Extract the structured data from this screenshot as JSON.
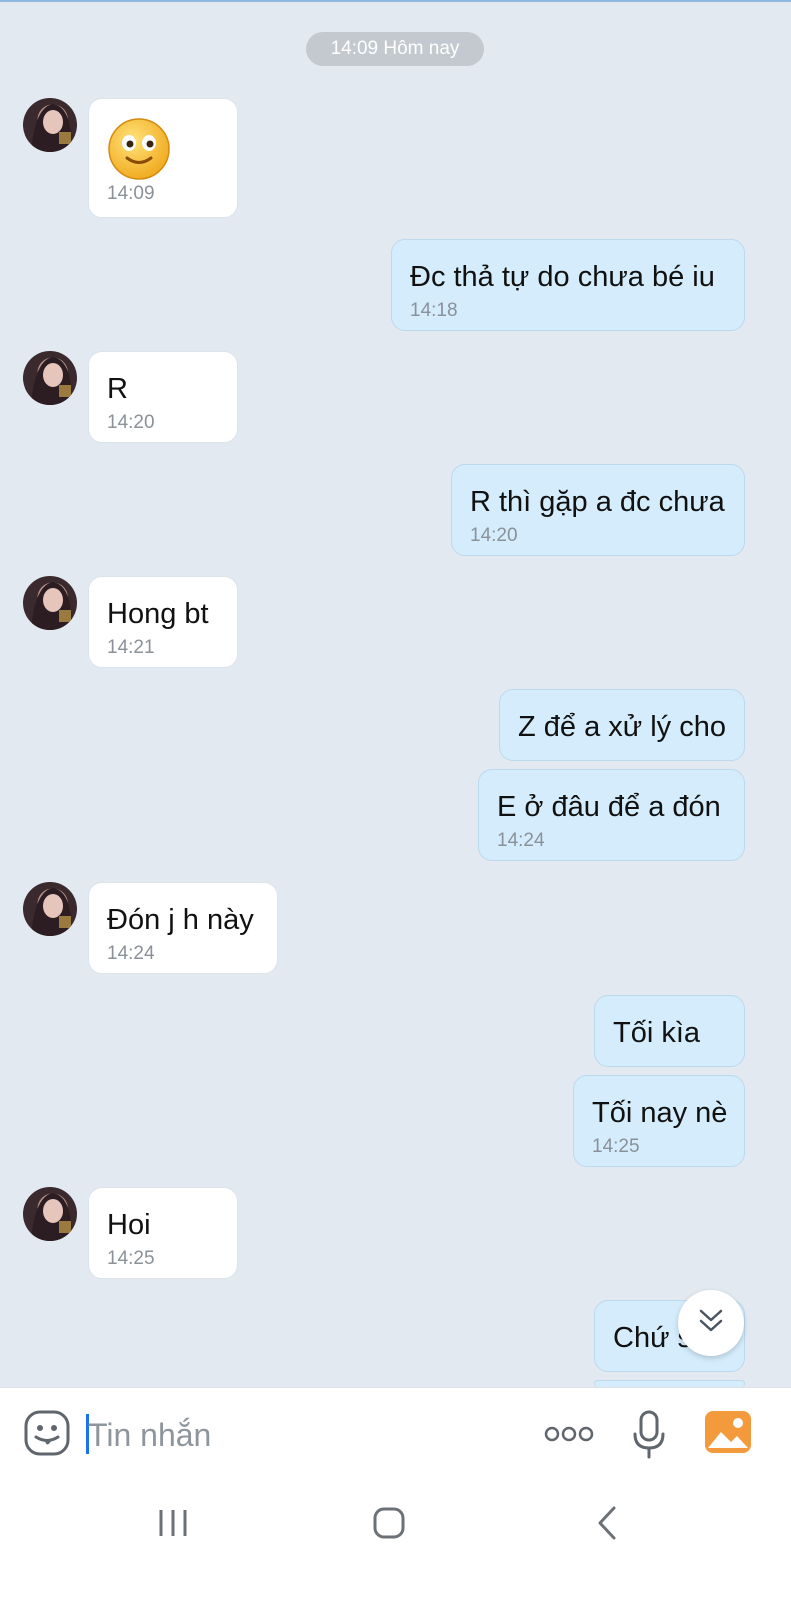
{
  "date_separator": "14:09 Hôm nay",
  "messages": [
    {
      "side": "in",
      "type": "emoji",
      "emoji": "slightly-smiling-face",
      "time": "14:09"
    },
    {
      "side": "out",
      "text": "Đc thả tự do chưa bé iu",
      "time": "14:18"
    },
    {
      "side": "in",
      "text": "R",
      "time": "14:20"
    },
    {
      "side": "out",
      "text": "R thì gặp a đc chưa",
      "time": "14:20"
    },
    {
      "side": "in",
      "text": "Hong bt",
      "time": "14:21"
    },
    {
      "side": "out",
      "text": "Z để a xử lý cho"
    },
    {
      "side": "out",
      "text": "E ở đâu để a đón",
      "time": "14:24"
    },
    {
      "side": "in",
      "text": "Đón j h này",
      "time": "14:24"
    },
    {
      "side": "out",
      "text": "Tối kìa"
    },
    {
      "side": "out",
      "text": "Tối nay nè",
      "time": "14:25"
    },
    {
      "side": "in",
      "text": "Hoi",
      "time": "14:25"
    },
    {
      "side": "out",
      "text": "Chứ s"
    }
  ],
  "composer": {
    "placeholder": "Tin nhắn",
    "icons": [
      "sticker-icon",
      "more-icon",
      "microphone-icon",
      "image-icon"
    ]
  },
  "scroll_button": {
    "icon": "double-chevron-down-icon"
  },
  "navbar": {
    "icons": [
      "recent-apps-icon",
      "home-icon",
      "back-icon"
    ]
  },
  "colors": {
    "background": "#e2e9f1",
    "incoming_bubble": "#ffffff",
    "outgoing_bubble": "#d4ecfb",
    "timestamp": "#8a9199",
    "date_pill": "#c4c9cf",
    "accent": "#1a73e8"
  }
}
